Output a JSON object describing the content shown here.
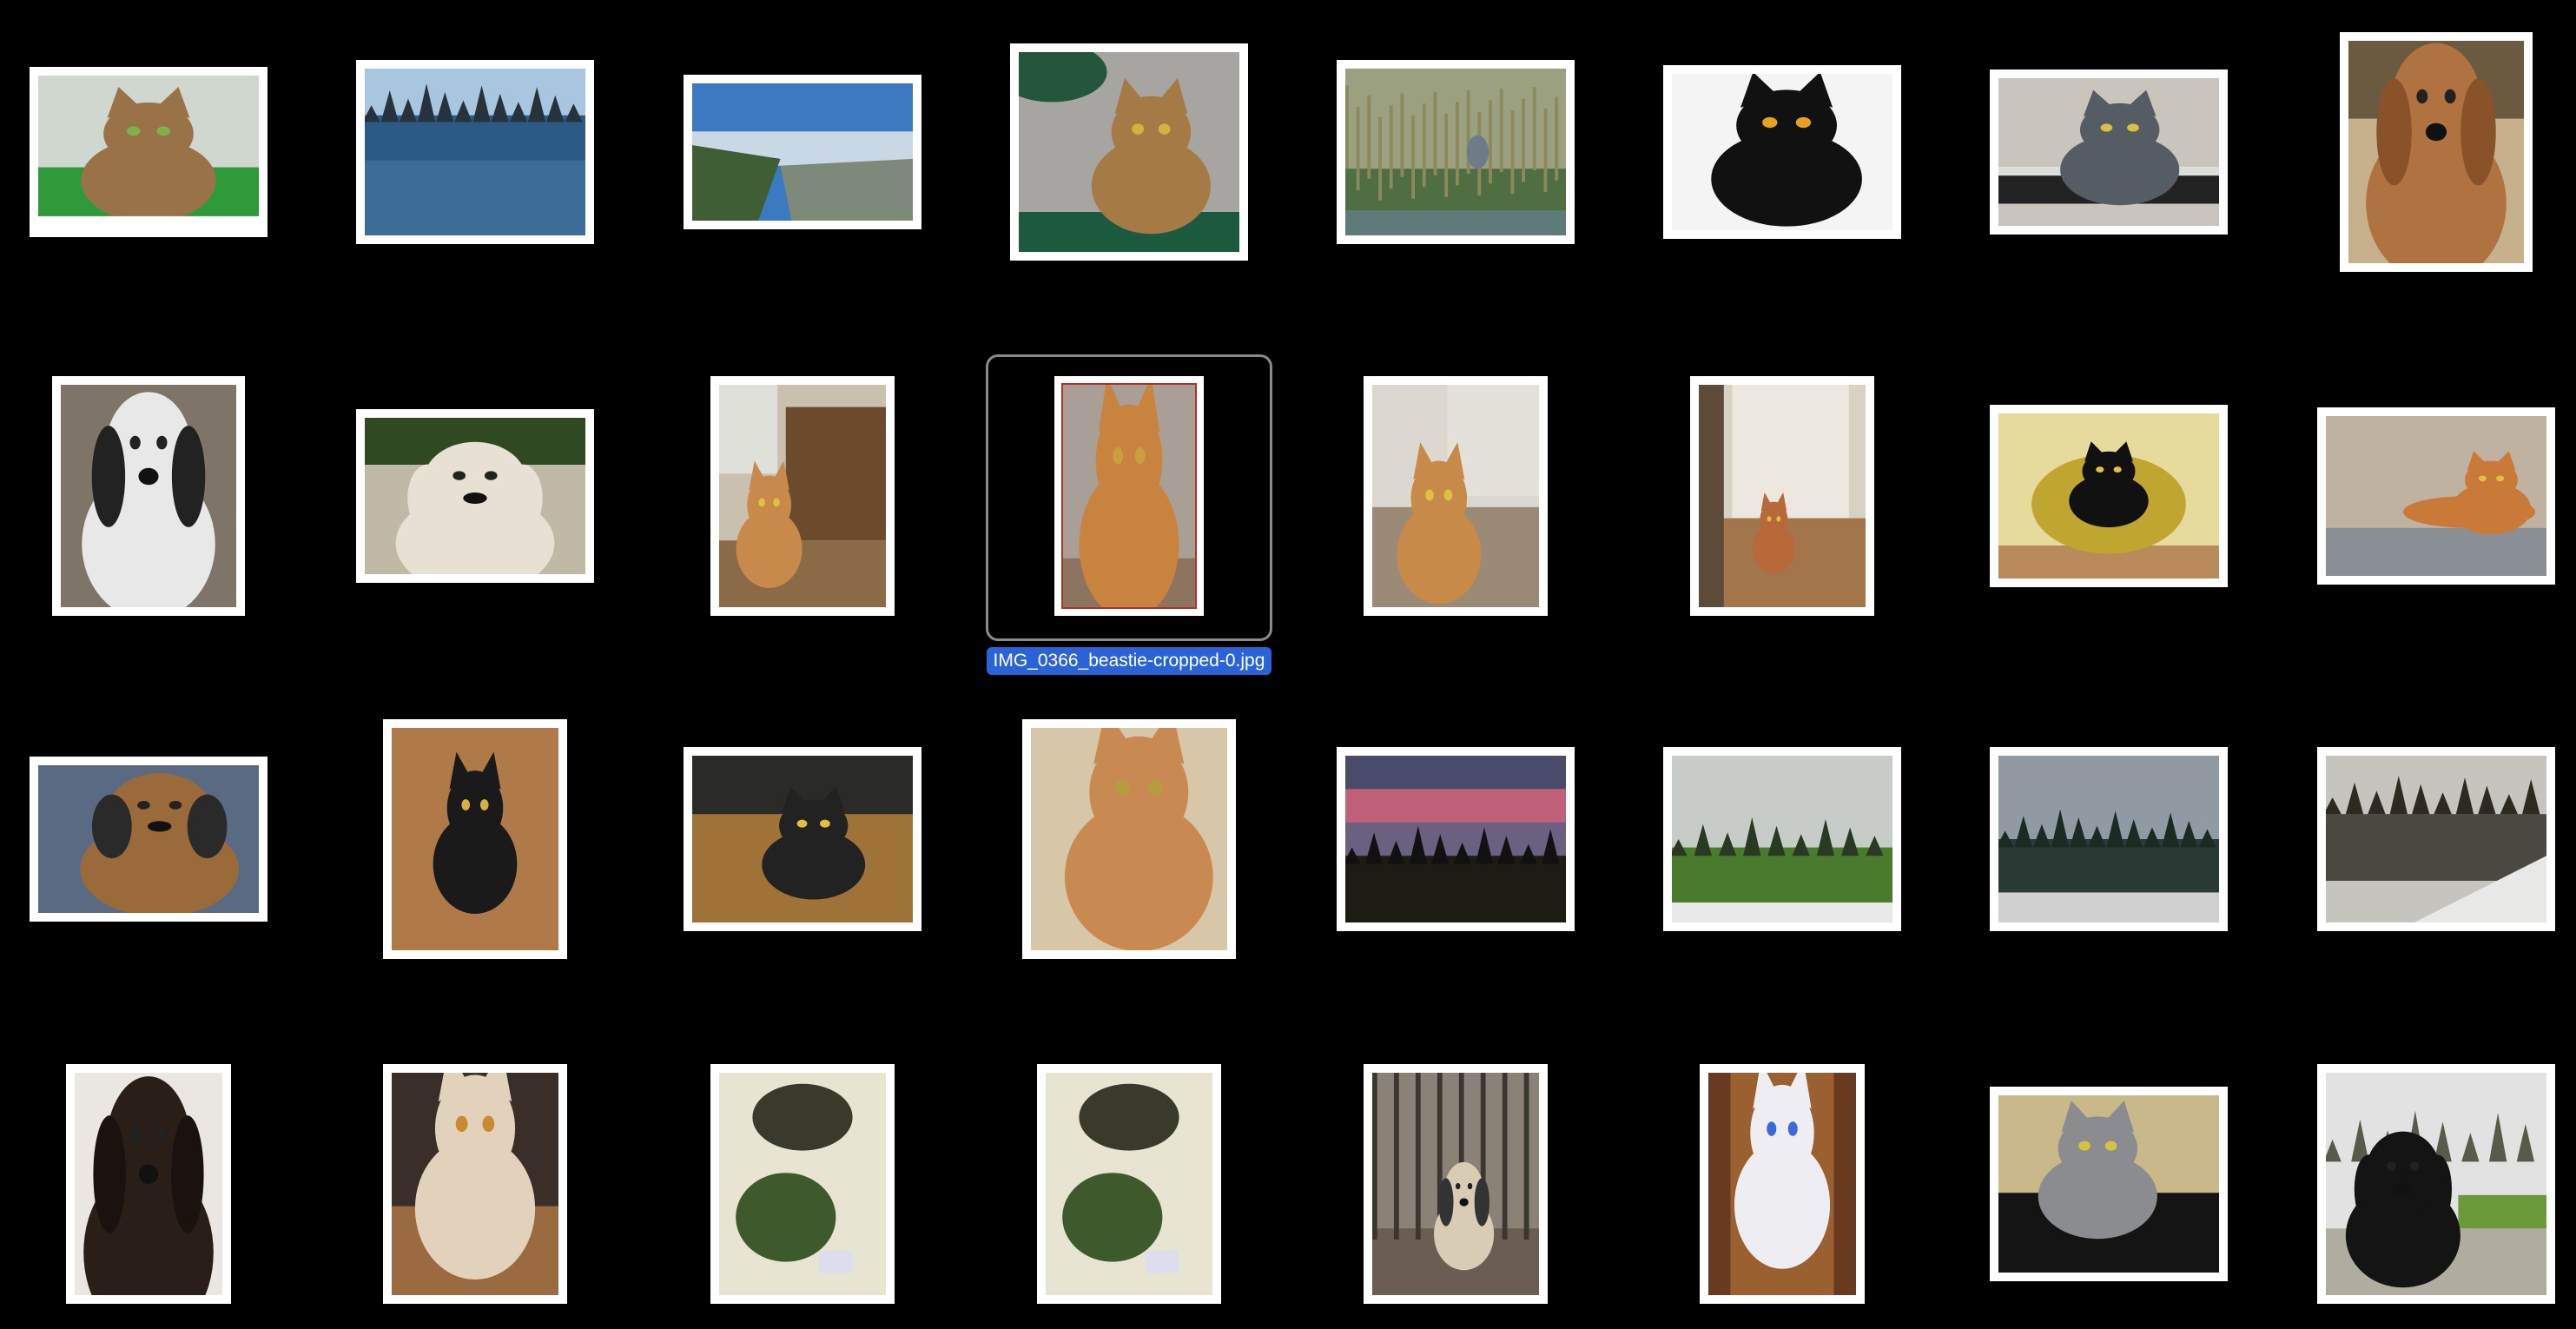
{
  "desktop": {
    "background": "#000000",
    "selected_filename": "IMG_0366_beastie-cropped-0.jpg",
    "selection_color": "#2a63d8"
  },
  "items": [
    {
      "name": "cat-green-blanket",
      "subject": "cat",
      "orientation": "landscape"
    },
    {
      "name": "rocky-coast-sea",
      "subject": "landscape",
      "orientation": "landscape"
    },
    {
      "name": "coast-cliffs-trees",
      "subject": "landscape",
      "orientation": "landscape"
    },
    {
      "name": "bengal-cat-tree",
      "subject": "cat",
      "orientation": "portrait"
    },
    {
      "name": "heron-marsh",
      "subject": "bird",
      "orientation": "landscape"
    },
    {
      "name": "black-cat-white",
      "subject": "cat",
      "orientation": "landscape"
    },
    {
      "name": "grey-cat-piano",
      "subject": "cat",
      "orientation": "landscape"
    },
    {
      "name": "cocker-spaniel",
      "subject": "dog",
      "orientation": "portrait"
    },
    {
      "name": "spaniel-snow",
      "subject": "dog",
      "orientation": "portrait"
    },
    {
      "name": "white-dog",
      "subject": "dog",
      "orientation": "landscape"
    },
    {
      "name": "cat-couch",
      "subject": "cat",
      "orientation": "portrait"
    },
    {
      "name": "orange-cat-selected",
      "subject": "cat",
      "orientation": "portrait"
    },
    {
      "name": "orange-cat-floor",
      "subject": "cat",
      "orientation": "portrait"
    },
    {
      "name": "cat-door",
      "subject": "cat",
      "orientation": "portrait"
    },
    {
      "name": "black-cat-yellow-chair",
      "subject": "cat",
      "orientation": "landscape"
    },
    {
      "name": "orange-cat-lying",
      "subject": "cat",
      "orientation": "landscape"
    },
    {
      "name": "dog-tile-floor",
      "subject": "dog",
      "orientation": "landscape"
    },
    {
      "name": "black-cat-wood-floor",
      "subject": "cat",
      "orientation": "portrait"
    },
    {
      "name": "black-cat-walking",
      "subject": "cat",
      "orientation": "landscape"
    },
    {
      "name": "fluffy-orange-cat",
      "subject": "cat",
      "orientation": "portrait"
    },
    {
      "name": "sunset-trees",
      "subject": "landscape",
      "orientation": "landscape"
    },
    {
      "name": "park-trees-snow",
      "subject": "landscape",
      "orientation": "landscape"
    },
    {
      "name": "misty-lake-snow",
      "subject": "landscape",
      "orientation": "landscape"
    },
    {
      "name": "pond-snow",
      "subject": "landscape",
      "orientation": "landscape"
    },
    {
      "name": "newfoundland-puppy",
      "subject": "dog",
      "orientation": "portrait"
    },
    {
      "name": "persian-cat-lap",
      "subject": "cat",
      "orientation": "portrait"
    },
    {
      "name": "green-crab-plate-1",
      "subject": "food",
      "orientation": "portrait"
    },
    {
      "name": "green-crab-plate-2",
      "subject": "food",
      "orientation": "portrait"
    },
    {
      "name": "pug-forest",
      "subject": "dog",
      "orientation": "portrait"
    },
    {
      "name": "white-kitten",
      "subject": "cat",
      "orientation": "portrait"
    },
    {
      "name": "grey-cat-suitcase",
      "subject": "cat",
      "orientation": "landscape"
    },
    {
      "name": "scottish-terrier",
      "subject": "dog",
      "orientation": "portrait"
    }
  ]
}
